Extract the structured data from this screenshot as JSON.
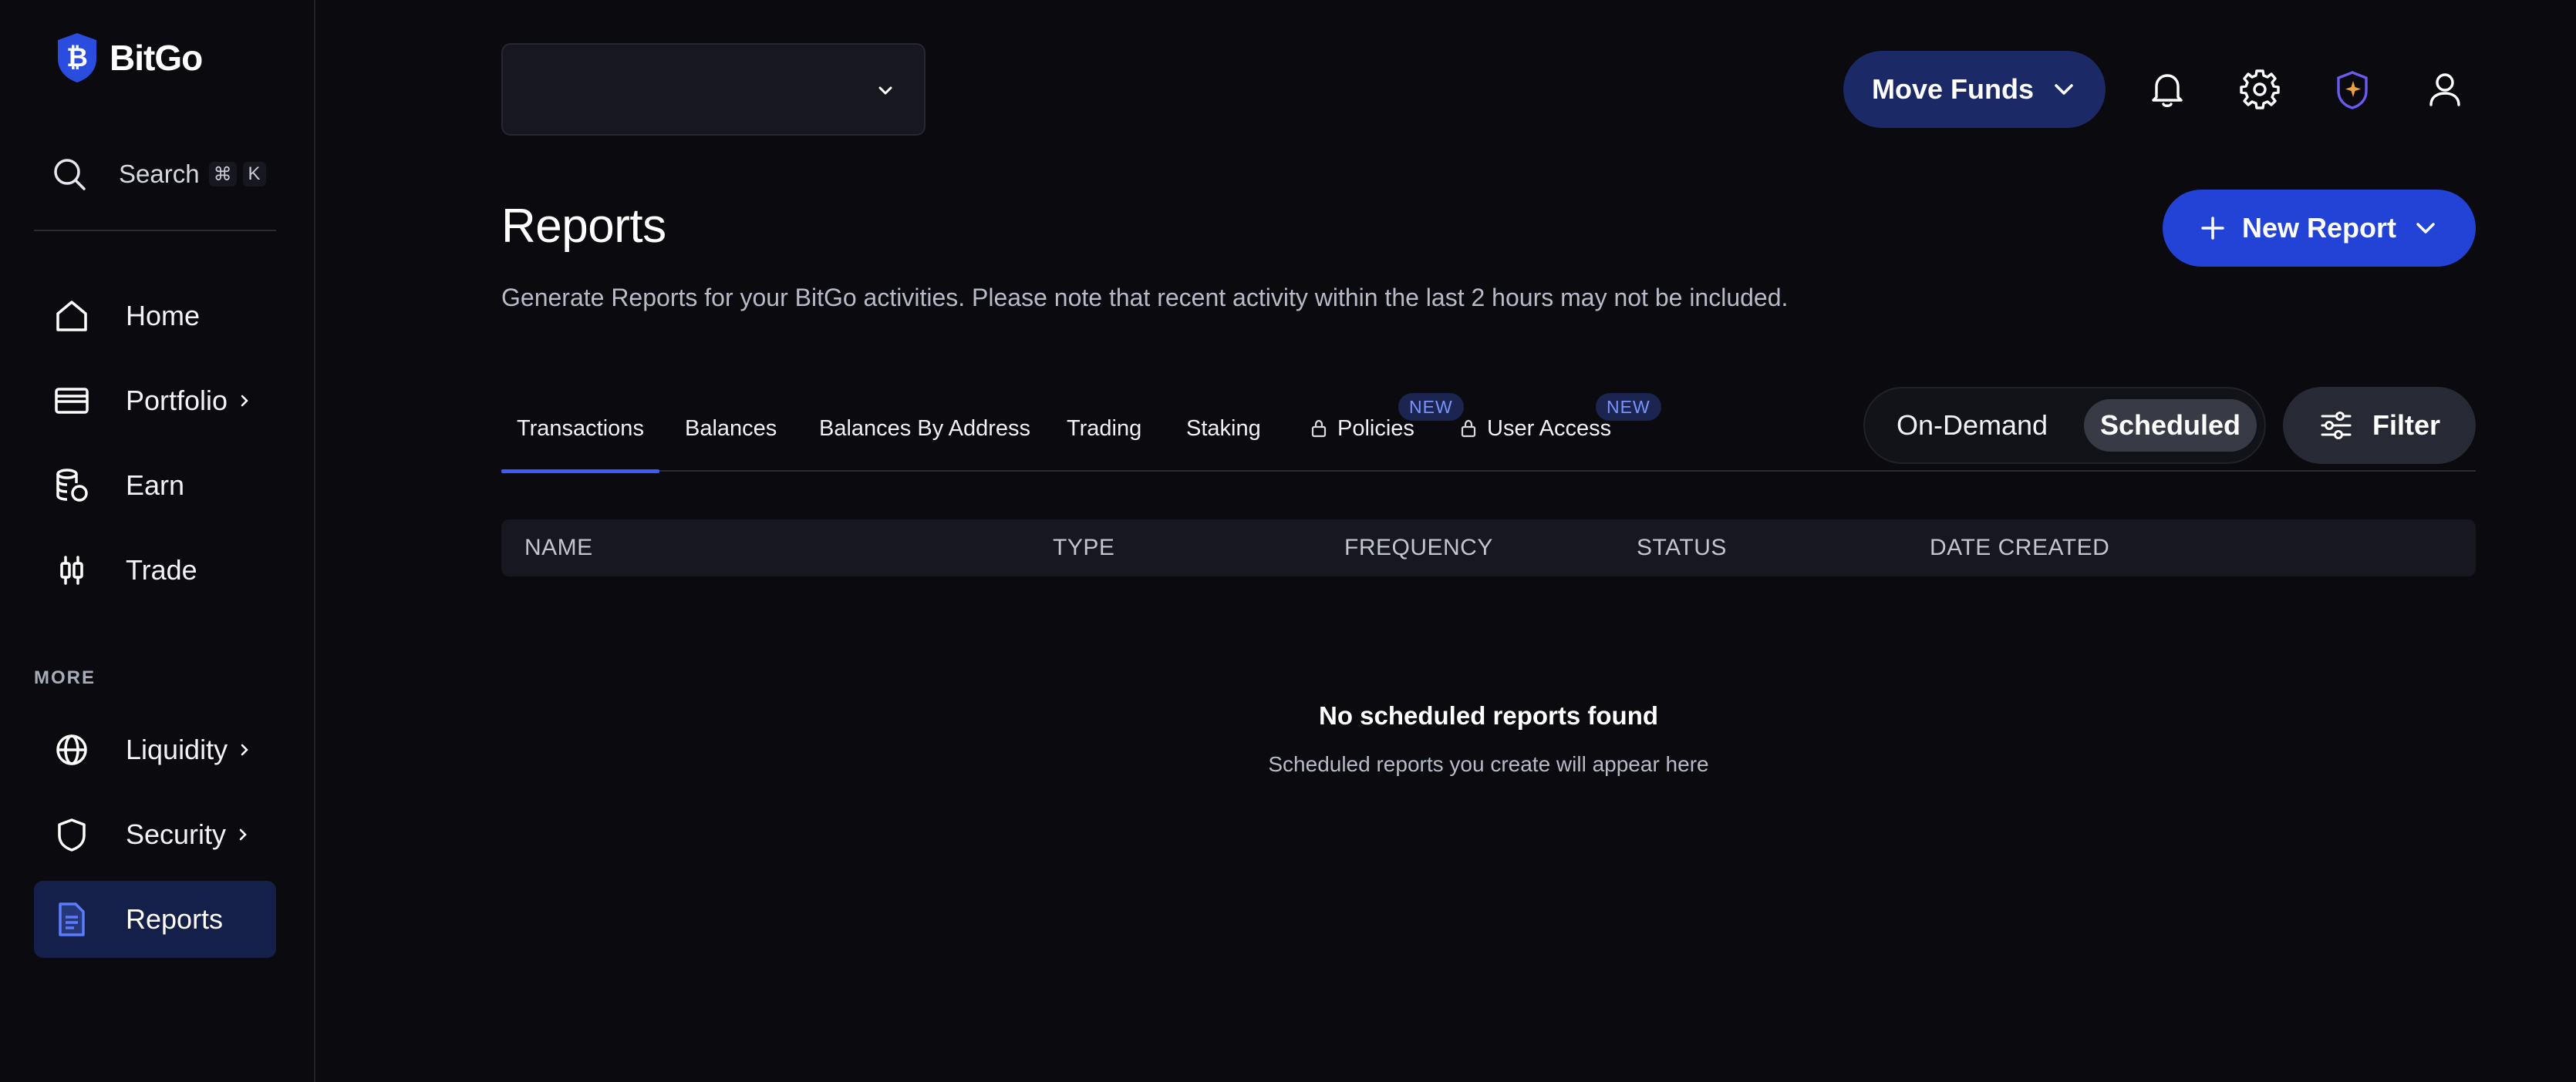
{
  "brand": {
    "name": "BitGo"
  },
  "search": {
    "label": "Search",
    "shortcut": [
      "⌘",
      "K"
    ]
  },
  "sidebar": {
    "items": [
      {
        "label": "Home"
      },
      {
        "label": "Portfolio"
      },
      {
        "label": "Earn"
      },
      {
        "label": "Trade"
      }
    ],
    "more_label": "MORE",
    "more_items": [
      {
        "label": "Liquidity"
      },
      {
        "label": "Security"
      },
      {
        "label": "Reports",
        "active": true
      }
    ]
  },
  "header": {
    "wallet_select": {
      "value": ""
    },
    "move_funds_label": "Move Funds",
    "icons": [
      "bell-icon",
      "gear-icon",
      "ai-assistant-icon",
      "user-icon"
    ]
  },
  "page": {
    "title": "Reports",
    "description": "Generate Reports for your BitGo activities. Please note that recent activity within the last 2 hours may not be included.",
    "new_report_label": "New Report"
  },
  "tabs": [
    {
      "label": "Transactions",
      "active": true
    },
    {
      "label": "Balances"
    },
    {
      "label": "Balances By Address"
    },
    {
      "label": "Trading"
    },
    {
      "label": "Staking"
    },
    {
      "label": "Policies",
      "locked": true,
      "badge": "NEW"
    },
    {
      "label": "User Access",
      "locked": true,
      "badge": "NEW"
    }
  ],
  "mode_toggle": {
    "options": [
      "On-Demand",
      "Scheduled"
    ],
    "selected": "Scheduled"
  },
  "filter_label": "Filter",
  "table": {
    "columns": [
      "NAME",
      "TYPE",
      "FREQUENCY",
      "STATUS",
      "DATE CREATED"
    ],
    "rows": []
  },
  "empty_state": {
    "title": "No scheduled reports found",
    "subtitle": "Scheduled reports you create will appear here"
  },
  "colors": {
    "background": "#0a0a0f",
    "accent": "#2343d6",
    "move_funds": "#1b2a66",
    "active_nav": "#15204a",
    "badge_text": "#7b93ff"
  }
}
